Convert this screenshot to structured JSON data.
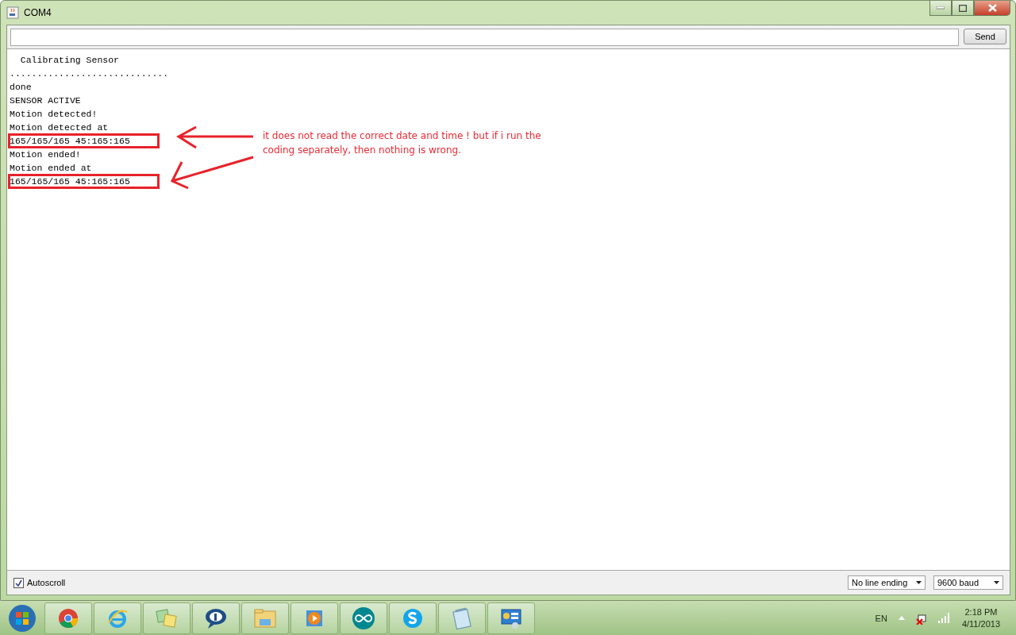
{
  "window": {
    "title": "COM4"
  },
  "send_button": "Send",
  "output_lines": [
    {
      "text": "  Calibrating Sensor",
      "boxed": false
    },
    {
      "text": ".............................",
      "boxed": false
    },
    {
      "text": "done",
      "boxed": false
    },
    {
      "text": "SENSOR ACTIVE",
      "boxed": false
    },
    {
      "text": "Motion detected!",
      "boxed": false
    },
    {
      "text": "Motion detected at",
      "boxed": false
    },
    {
      "text": "165/165/165 45:165:165",
      "boxed": true
    },
    {
      "text": "Motion ended!",
      "boxed": false
    },
    {
      "text": "Motion ended at",
      "boxed": false
    },
    {
      "text": "165/165/165 45:165:165",
      "boxed": true
    }
  ],
  "annotation": {
    "note": "it does not read the correct date and time ! but if i run the coding separately, then nothing is wrong."
  },
  "autoscroll": {
    "label": "Autoscroll",
    "checked": true
  },
  "line_ending": {
    "value": "No line ending"
  },
  "baud": {
    "value": "9600 baud"
  },
  "tray": {
    "language": "EN",
    "time": "2:18 PM",
    "date": "4/11/2013"
  }
}
